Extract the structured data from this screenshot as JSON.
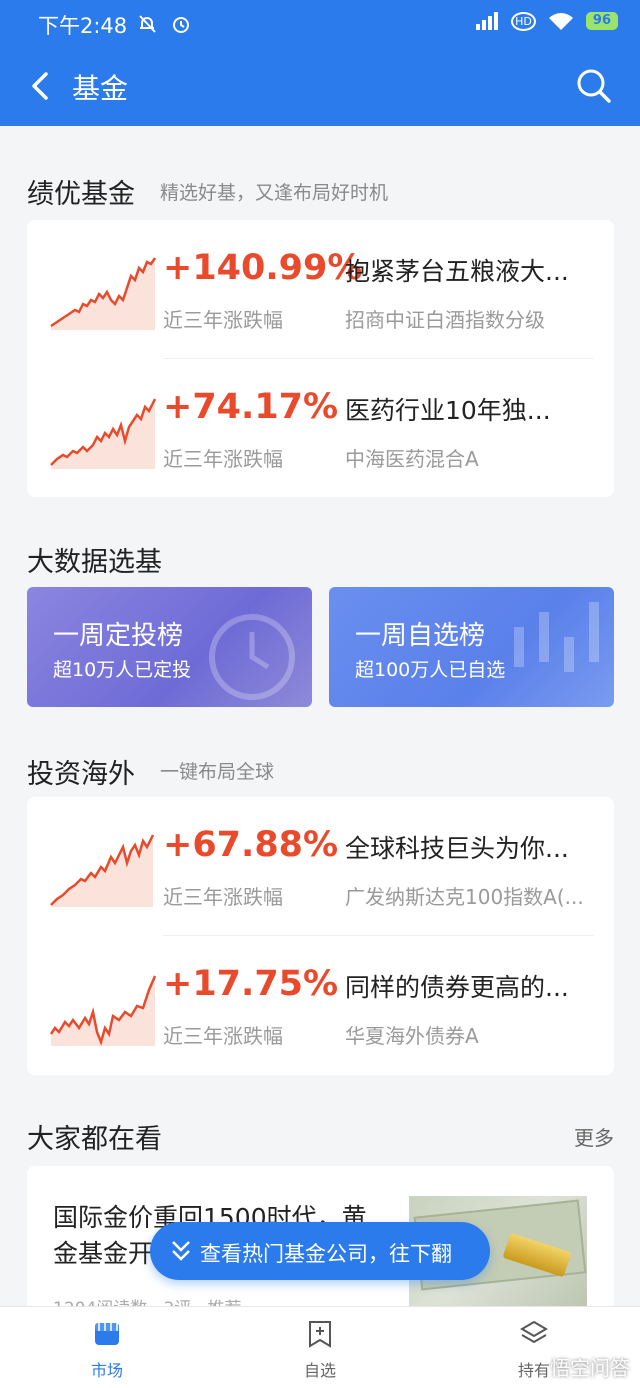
{
  "status_bar": {
    "time": "下午2:48",
    "hd": "HD",
    "battery": "96"
  },
  "appbar": {
    "title": "基金"
  },
  "performance": {
    "title": "绩优基金",
    "subtitle": "精选好基，又逢布局好时机",
    "funds": [
      {
        "pct": "+140.99%",
        "pct_label": "近三年涨跌幅",
        "name": "抱紧茅台五粮液大...",
        "sub": "招商中证白酒指数分级"
      },
      {
        "pct": "+74.17%",
        "pct_label": "近三年涨跌幅",
        "name": "医药行业10年独...",
        "sub": "中海医药混合A"
      }
    ]
  },
  "bigdata": {
    "title": "大数据选基",
    "left": {
      "title": "一周定投榜",
      "sub": "超10万人已定投"
    },
    "right": {
      "title": "一周自选榜",
      "sub": "超100万人已自选"
    }
  },
  "overseas": {
    "title": "投资海外",
    "subtitle": "一键布局全球",
    "funds": [
      {
        "pct": "+67.88%",
        "pct_label": "近三年涨跌幅",
        "name": "全球科技巨头为你...",
        "sub": "广发纳斯达克100指数A(..."
      },
      {
        "pct": "+17.75%",
        "pct_label": "近三年涨跌幅",
        "name": "同样的债券更高的...",
        "sub": "华夏海外债券A"
      }
    ]
  },
  "watching": {
    "title": "大家都在看",
    "more": "更多",
    "article": {
      "title": "国际金价重回1500时代，黄金基金开...",
      "meta": "1204阅读数 · 3评 · 推荐"
    }
  },
  "floating": {
    "label": "查看热门基金公司，往下翻"
  },
  "tabs": [
    {
      "label": "市场"
    },
    {
      "label": "自选"
    },
    {
      "label": "持有"
    }
  ],
  "watermark": "悟空问答",
  "colors": {
    "primary": "#2b7bec",
    "gain": "#ea4a2c"
  }
}
